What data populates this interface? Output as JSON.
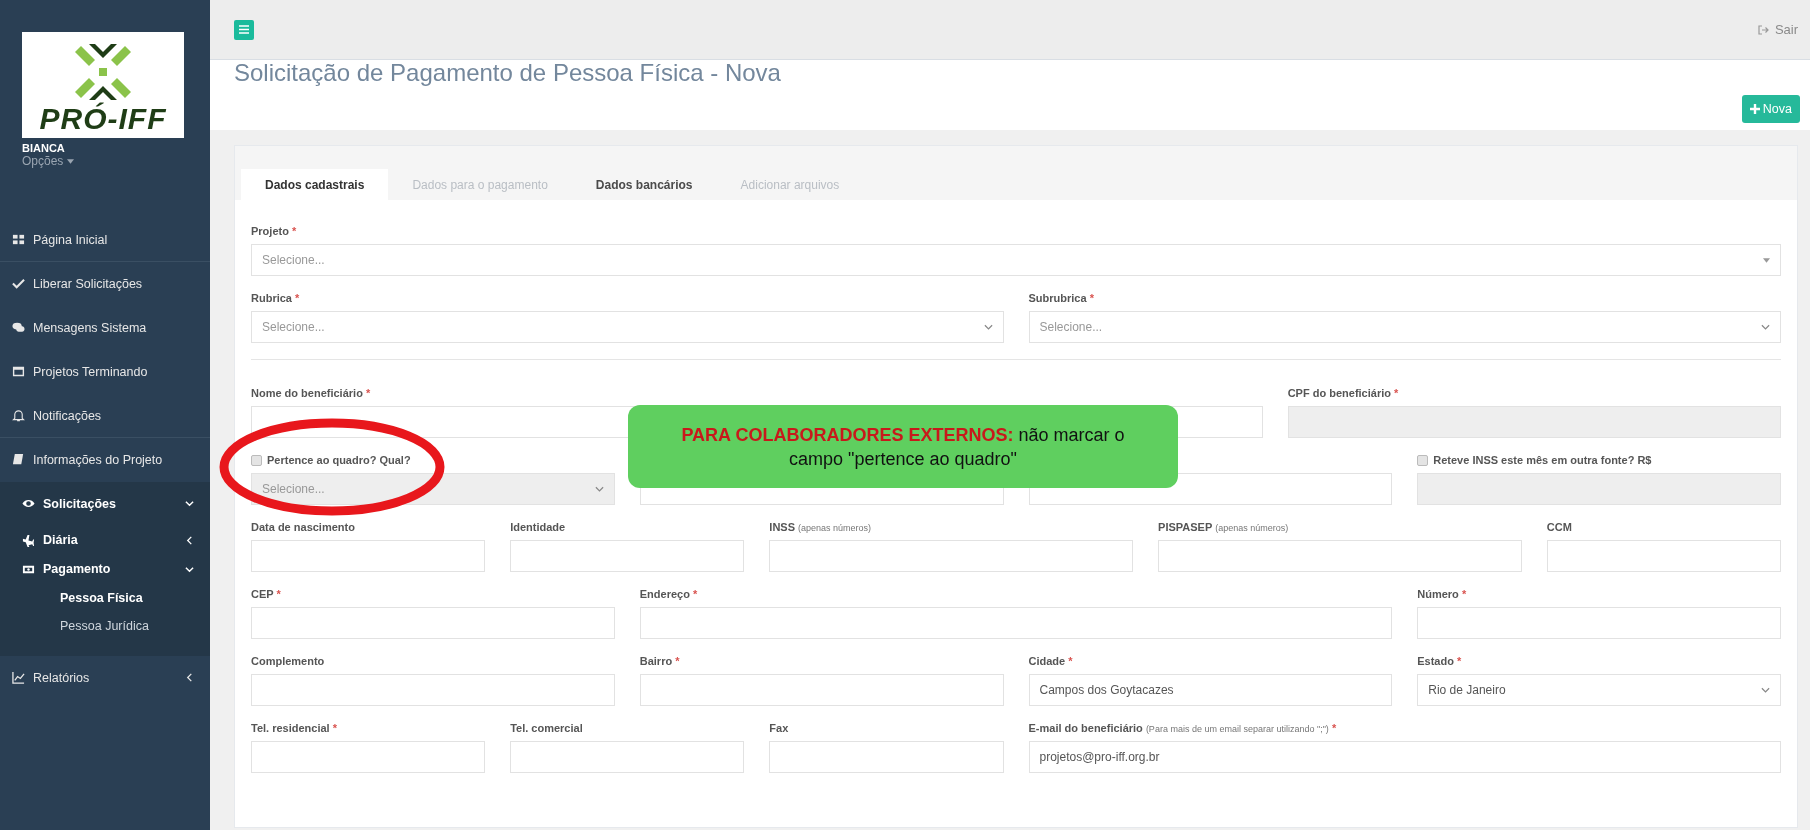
{
  "sidebar": {
    "logo_text": "PRÓ-IFF",
    "user": "BIANCA",
    "options": "Opções",
    "menu": [
      {
        "label": "Página Inicial",
        "selected": false
      },
      {
        "label": "Liberar Solicitações",
        "selected": false
      },
      {
        "label": "Mensagens Sistema",
        "selected": false
      },
      {
        "label": "Projetos Terminando",
        "selected": false
      },
      {
        "label": "Notificações",
        "selected": false
      },
      {
        "label": "Informações do Projeto",
        "selected": false
      },
      {
        "label": "Solicitações",
        "selected": false,
        "expanded": true,
        "children": [
          {
            "label": "Diária",
            "selected": false,
            "expanded": false
          },
          {
            "label": "Pagamento",
            "selected": false,
            "expanded": true,
            "children": [
              {
                "label": "Pessoa Física",
                "selected": true
              },
              {
                "label": "Pessoa Jurídica",
                "selected": false
              }
            ]
          }
        ]
      },
      {
        "label": "Relatórios",
        "selected": false,
        "expanded": false
      }
    ]
  },
  "topbar": {
    "logout": "Sair"
  },
  "page": {
    "title": "Solicitação de Pagamento de Pessoa Física - Nova",
    "new_button": "Nova"
  },
  "tabs": [
    {
      "label": "Dados cadastrais",
      "selected": true,
      "disabled": false
    },
    {
      "label": "Dados para o pagamento",
      "selected": false,
      "disabled": true
    },
    {
      "label": "Dados bancários",
      "selected": false,
      "disabled": false
    },
    {
      "label": "Adicionar arquivos",
      "selected": false,
      "disabled": true
    }
  ],
  "form": {
    "rows": [
      [
        {
          "kind": "combo",
          "label": "Projeto",
          "required": true,
          "required_mark": "*",
          "placeholder": "Selecione..."
        }
      ],
      [
        {
          "kind": "select",
          "label": "Rubrica",
          "required": true,
          "required_mark": "*",
          "placeholder": "Selecione..."
        },
        {
          "kind": "select",
          "label": "Subrubrica",
          "required": true,
          "required_mark": "*",
          "placeholder": "Selecione..."
        }
      ],
      [
        {
          "kind": "text",
          "label": "Nome do beneficiário",
          "required": true,
          "required_mark": "*"
        },
        {
          "kind": "text",
          "label": "CPF do beneficiário",
          "required": true,
          "required_mark": "*",
          "disabled": true
        }
      ],
      [
        {
          "kind": "check-select",
          "label": "Pertence ao quadro? Qual?",
          "checked": false,
          "placeholder": "Selecione...",
          "disabled": true
        },
        {
          "kind": "text"
        },
        {
          "kind": "text"
        },
        {
          "kind": "check-text",
          "label": "Reteve INSS este mês em outra fonte? R$",
          "checked": false,
          "disabled": true
        }
      ],
      [
        {
          "kind": "text",
          "label": "Data de nascimento"
        },
        {
          "kind": "text",
          "label": "Identidade"
        },
        {
          "kind": "text",
          "label": "INSS",
          "note": "(apenas números)"
        },
        {
          "kind": "text",
          "label": "PISPASEP",
          "note": "(apenas números)"
        },
        {
          "kind": "text",
          "label": "CCM"
        }
      ],
      [
        {
          "kind": "text",
          "label": "CEP",
          "required": true,
          "required_mark": "*"
        },
        {
          "kind": "text",
          "label": "Endereço",
          "required": true,
          "required_mark": "*"
        },
        {
          "kind": "text",
          "label": "Número",
          "required": true,
          "required_mark": "*"
        }
      ],
      [
        {
          "kind": "text",
          "label": "Complemento"
        },
        {
          "kind": "text",
          "label": "Bairro",
          "required": true,
          "required_mark": "*"
        },
        {
          "kind": "text",
          "label": "Cidade",
          "required": true,
          "required_mark": "*",
          "value": "Campos dos Goytacazes"
        },
        {
          "kind": "select",
          "label": "Estado",
          "required": true,
          "required_mark": "*",
          "value": "Rio de Janeiro"
        }
      ],
      [
        {
          "kind": "text",
          "label": "Tel. residencial",
          "required": true,
          "required_mark": "*"
        },
        {
          "kind": "text",
          "label": "Tel. comercial"
        },
        {
          "kind": "text",
          "label": "Fax"
        },
        {
          "kind": "text",
          "label": "E-mail do beneficiário",
          "note": "(Para mais de um email separar utilizando \";\")",
          "required": true,
          "required_mark": "*",
          "value": "projetos@pro-iff.org.br"
        }
      ]
    ]
  },
  "callout": {
    "text": "**PARA COLABORADORES EXTERNOS:** não marcar o campo \"pertence ao quadro\""
  }
}
